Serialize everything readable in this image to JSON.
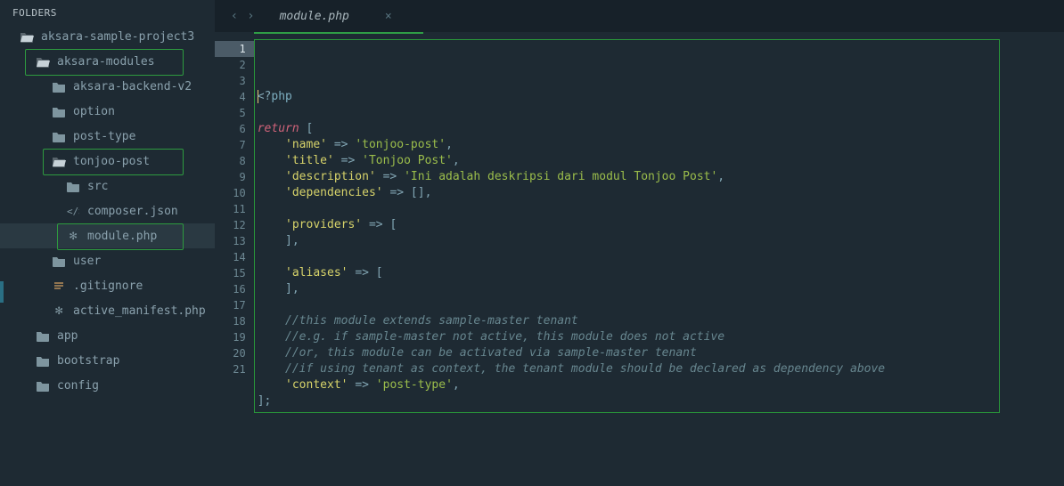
{
  "sidebar": {
    "header": "FOLDERS",
    "items": [
      {
        "label": "aksara-sample-project3",
        "icon": "folder-open",
        "lvl": 0,
        "hl": false
      },
      {
        "label": "aksara-modules",
        "icon": "folder-open",
        "lvl": 1,
        "hl": true,
        "hlClass": "hl"
      },
      {
        "label": "aksara-backend-v2",
        "icon": "folder",
        "lvl": 2,
        "hl": false
      },
      {
        "label": "option",
        "icon": "folder",
        "lvl": 2,
        "hl": false
      },
      {
        "label": "post-type",
        "icon": "folder",
        "lvl": 2,
        "hl": false
      },
      {
        "label": "tonjoo-post",
        "icon": "folder-open",
        "lvl": 2,
        "hl": true,
        "hlClass": "hl hl2"
      },
      {
        "label": "src",
        "icon": "folder",
        "lvl": 3,
        "hl": false
      },
      {
        "label": "composer.json",
        "icon": "code",
        "lvl": 3,
        "hl": false
      },
      {
        "label": "module.php",
        "icon": "file",
        "lvl": 3,
        "hl": true,
        "hlClass": "hl hl3",
        "selected": true
      },
      {
        "label": "user",
        "icon": "folder",
        "lvl": 2,
        "hl": false
      },
      {
        "label": ".gitignore",
        "icon": "lines",
        "lvl": 2,
        "hl": false
      },
      {
        "label": "active_manifest.php",
        "icon": "file",
        "lvl": 2,
        "hl": false
      },
      {
        "label": "app",
        "icon": "folder",
        "lvl": 1,
        "hl": false
      },
      {
        "label": "bootstrap",
        "icon": "folder",
        "lvl": 1,
        "hl": false
      },
      {
        "label": "config",
        "icon": "folder",
        "lvl": 1,
        "hl": false
      }
    ]
  },
  "tab": {
    "title": "module.php",
    "close": "×"
  },
  "nav": {
    "back": "‹",
    "fwd": "›"
  },
  "code": {
    "lines": [
      {
        "n": 1,
        "active": true,
        "seg": [
          {
            "html": "<span class='cursor'></span><span class='pn'>&lt;?</span><span class='tag'>php</span>"
          }
        ]
      },
      {
        "n": 2,
        "seg": [
          {
            "html": ""
          }
        ]
      },
      {
        "n": 3,
        "seg": [
          {
            "html": "<span class='kw'>return</span> <span class='pn'>[</span>"
          }
        ]
      },
      {
        "n": 4,
        "seg": [
          {
            "html": "    <span class='key'>'name'</span> <span class='pn'>=&gt;</span> <span class='str'>'tonjoo-post'</span><span class='pn'>,</span>"
          }
        ]
      },
      {
        "n": 5,
        "seg": [
          {
            "html": "    <span class='key'>'title'</span> <span class='pn'>=&gt;</span> <span class='str'>'Tonjoo Post'</span><span class='pn'>,</span>"
          }
        ]
      },
      {
        "n": 6,
        "seg": [
          {
            "html": "    <span class='key'>'description'</span> <span class='pn'>=&gt;</span> <span class='str'>'Ini adalah deskripsi dari modul Tonjoo Post'</span><span class='pn'>,</span>"
          }
        ]
      },
      {
        "n": 7,
        "seg": [
          {
            "html": "    <span class='key'>'dependencies'</span> <span class='pn'>=&gt;</span> <span class='pn'>[],</span>"
          }
        ]
      },
      {
        "n": 8,
        "seg": [
          {
            "html": ""
          }
        ]
      },
      {
        "n": 9,
        "seg": [
          {
            "html": "    <span class='key'>'providers'</span> <span class='pn'>=&gt;</span> <span class='pn'>[</span>"
          }
        ]
      },
      {
        "n": 10,
        "seg": [
          {
            "html": "    <span class='pn'>],</span>"
          }
        ]
      },
      {
        "n": 11,
        "seg": [
          {
            "html": ""
          }
        ]
      },
      {
        "n": 12,
        "seg": [
          {
            "html": "    <span class='key'>'aliases'</span> <span class='pn'>=&gt;</span> <span class='pn'>[</span>"
          }
        ]
      },
      {
        "n": 13,
        "seg": [
          {
            "html": "    <span class='pn'>],</span>"
          }
        ]
      },
      {
        "n": 14,
        "seg": [
          {
            "html": ""
          }
        ]
      },
      {
        "n": 15,
        "seg": [
          {
            "html": "    <span class='cm'>//this module extends sample-master tenant</span>"
          }
        ]
      },
      {
        "n": 16,
        "seg": [
          {
            "html": "    <span class='cm'>//e.g. if sample-master not active, this module does not active</span>"
          }
        ]
      },
      {
        "n": 17,
        "seg": [
          {
            "html": "    <span class='cm'>//or, this module can be activated via sample-master tenant</span>"
          }
        ]
      },
      {
        "n": 18,
        "seg": [
          {
            "html": "    <span class='cm'>//if using tenant as context, the tenant module should be declared as dependency above</span>"
          }
        ]
      },
      {
        "n": 19,
        "seg": [
          {
            "html": "    <span class='key'>'context'</span> <span class='pn'>=&gt;</span> <span class='str'>'post-type'</span><span class='pn'>,</span>"
          }
        ]
      },
      {
        "n": 20,
        "seg": [
          {
            "html": "<span class='pn'>];</span>"
          }
        ]
      },
      {
        "n": 21,
        "seg": [
          {
            "html": ""
          }
        ]
      }
    ]
  }
}
